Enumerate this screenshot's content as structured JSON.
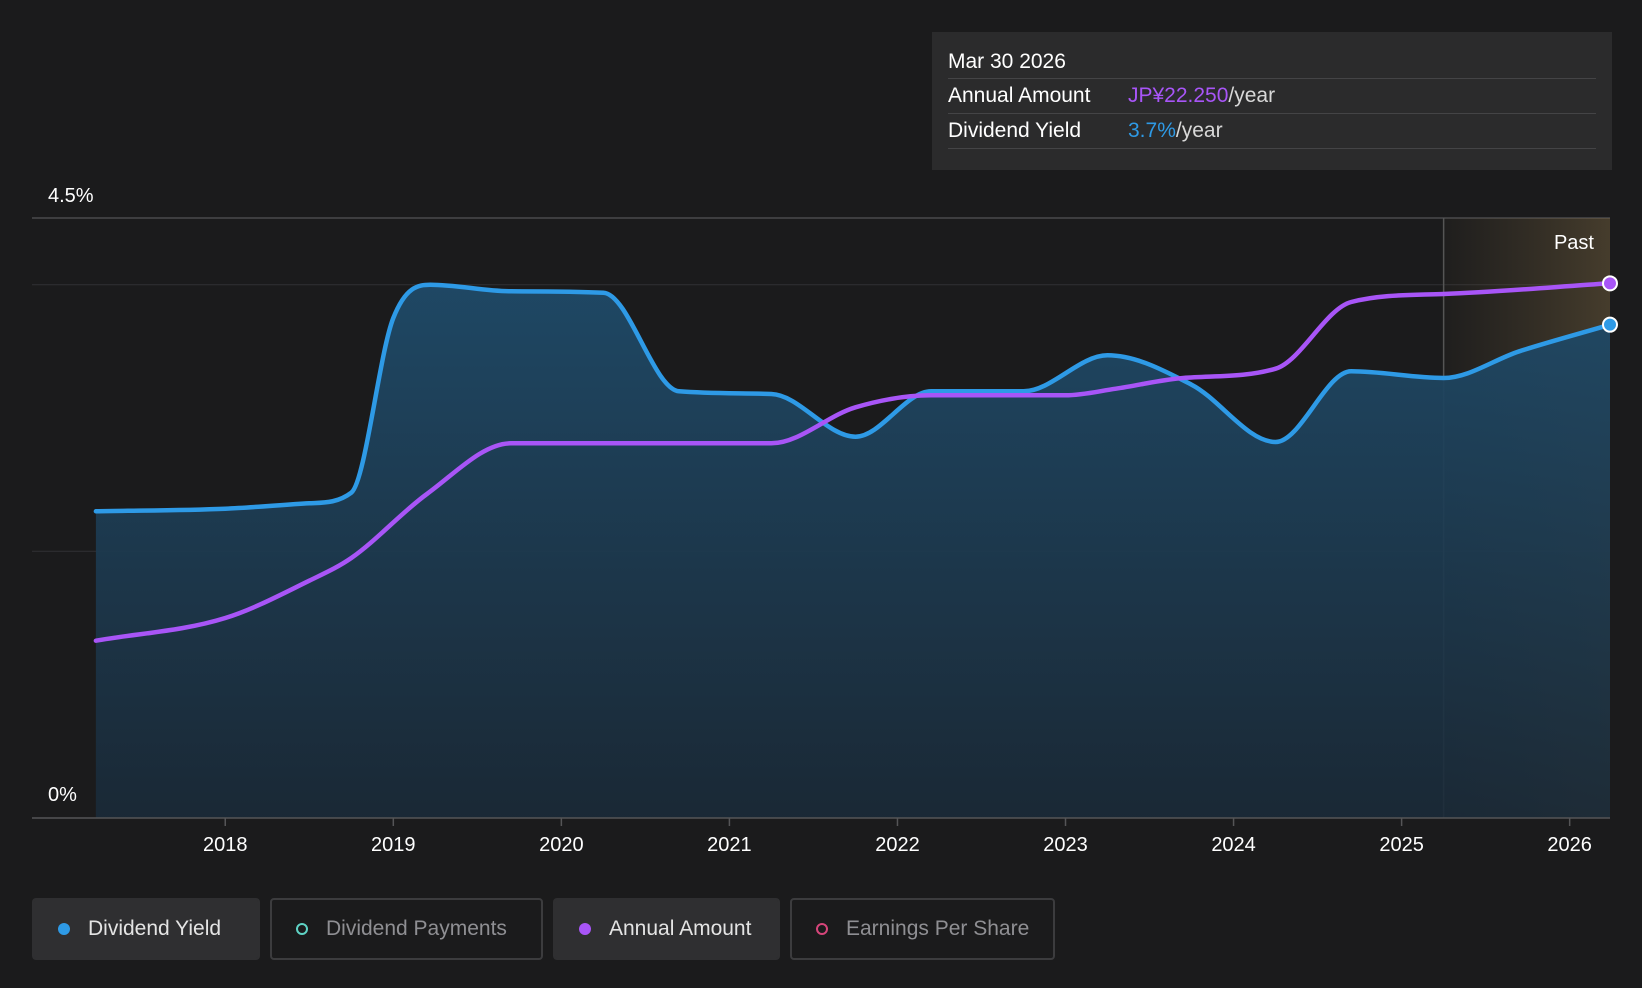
{
  "tooltip": {
    "date": "Mar 30 2026",
    "rows": [
      {
        "label": "Annual Amount",
        "value": "JP¥22.250",
        "unit": "/year"
      },
      {
        "label": "Dividend Yield",
        "value": "3.7%",
        "unit": "/year"
      }
    ]
  },
  "past_label": "Past",
  "legend": [
    {
      "label": "Dividend Yield",
      "color": "#2e9ae6",
      "active": true,
      "filled": true
    },
    {
      "label": "Dividend Payments",
      "color": "#5fd3c5",
      "active": false,
      "filled": false
    },
    {
      "label": "Annual Amount",
      "color": "#a855f7",
      "active": true,
      "filled": true
    },
    {
      "label": "Earnings Per Share",
      "color": "#d6457a",
      "active": false,
      "filled": false
    }
  ],
  "colors": {
    "yield": "#2e9ae6",
    "annual": "#a855f7",
    "background": "#1b1b1c"
  },
  "chart_data": {
    "type": "area",
    "x_ticks": [
      2018,
      2019,
      2020,
      2021,
      2022,
      2023,
      2024,
      2025,
      2026
    ],
    "y_tick_labels": [
      "4.5%",
      "0%"
    ],
    "ylim": [
      0,
      4.5
    ],
    "xlim": [
      2016.85,
      2026.24
    ],
    "past_start": 2025.25,
    "series": [
      {
        "name": "Dividend Yield",
        "unit": "%",
        "points": [
          [
            2017.23,
            2.3
          ],
          [
            2018.0,
            2.32
          ],
          [
            2018.5,
            2.36
          ],
          [
            2018.75,
            2.44
          ],
          [
            2019.0,
            3.75
          ],
          [
            2019.22,
            4.0
          ],
          [
            2019.7,
            3.95
          ],
          [
            2020.25,
            3.94
          ],
          [
            2020.7,
            3.2
          ],
          [
            2021.25,
            3.18
          ],
          [
            2021.75,
            2.86
          ],
          [
            2022.2,
            3.2
          ],
          [
            2022.75,
            3.2
          ],
          [
            2023.25,
            3.47
          ],
          [
            2023.75,
            3.25
          ],
          [
            2024.25,
            2.82
          ],
          [
            2024.7,
            3.35
          ],
          [
            2025.25,
            3.3
          ],
          [
            2025.7,
            3.5
          ],
          [
            2026.24,
            3.7
          ]
        ]
      },
      {
        "name": "Annual Amount",
        "unit": "%",
        "points": [
          [
            2017.23,
            1.33
          ],
          [
            2018.0,
            1.5
          ],
          [
            2018.5,
            1.78
          ],
          [
            2018.75,
            1.95
          ],
          [
            2019.2,
            2.43
          ],
          [
            2019.7,
            2.81
          ],
          [
            2021.25,
            2.81
          ],
          [
            2021.75,
            3.08
          ],
          [
            2022.2,
            3.17
          ],
          [
            2023.0,
            3.17
          ],
          [
            2023.3,
            3.22
          ],
          [
            2023.7,
            3.3
          ],
          [
            2024.25,
            3.37
          ],
          [
            2024.7,
            3.87
          ],
          [
            2025.25,
            3.93
          ],
          [
            2026.24,
            4.01
          ]
        ]
      }
    ]
  }
}
